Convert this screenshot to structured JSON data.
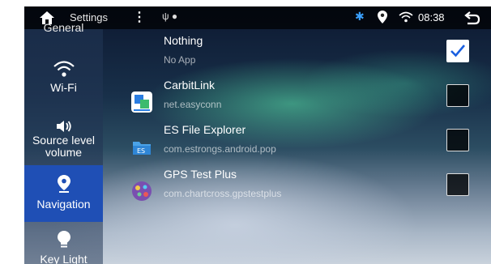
{
  "statusbar": {
    "title": "Settings",
    "menu_glyph": "⋮",
    "usb_glyph": "ψ ●",
    "bluetooth_glyph": "✱",
    "time": "08:38"
  },
  "sidebar": {
    "items": [
      {
        "label": "General",
        "icon": "general-icon",
        "active": false
      },
      {
        "label": "Wi-Fi",
        "icon": "wifi-icon",
        "active": false
      },
      {
        "label": "Source level volume",
        "icon": "speaker-icon",
        "active": false
      },
      {
        "label": "Navigation",
        "icon": "location-pin-icon",
        "active": true
      },
      {
        "label": "Key Light",
        "icon": "bulb-icon",
        "active": false
      }
    ]
  },
  "apps": [
    {
      "name": "Nothing",
      "package": "No App",
      "checked": true
    },
    {
      "name": "CarbitLink",
      "package": "net.easyconn",
      "checked": false,
      "icon": "carbitlink-app-icon"
    },
    {
      "name": "ES File Explorer",
      "package": "com.estrongs.android.pop",
      "checked": false,
      "icon": "es-file-explorer-app-icon"
    },
    {
      "name": "GPS Test Plus",
      "package": "com.chartcross.gpstestplus",
      "checked": false,
      "icon": "gps-test-plus-app-icon"
    }
  ],
  "colors": {
    "accent": "#1f4fb5",
    "check": "#1a5fe0",
    "bluetooth": "#3aa0ff"
  }
}
